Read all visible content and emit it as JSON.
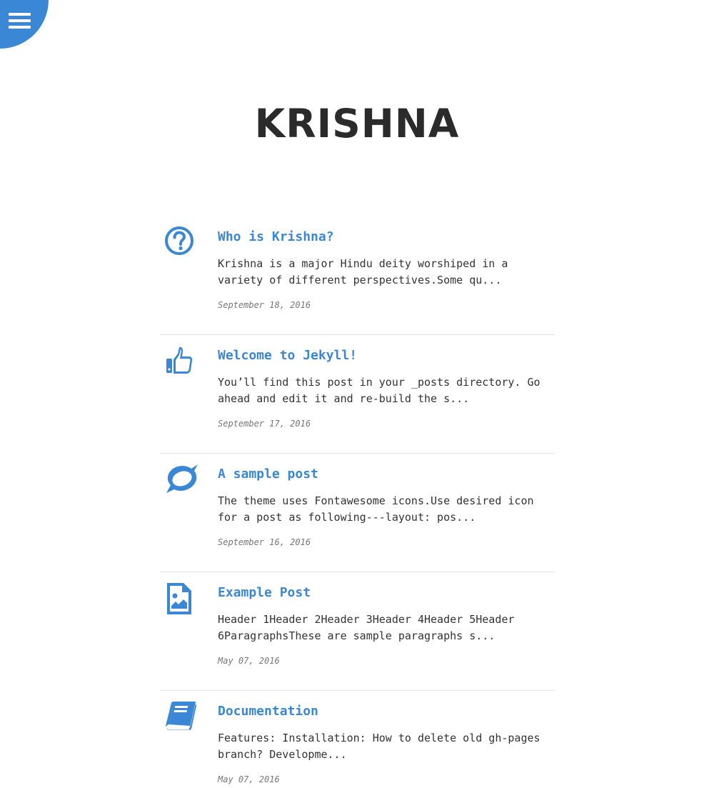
{
  "colors": {
    "accent": "#3a87d6",
    "title": "#2b2b2b",
    "text": "#333333",
    "date": "#777777",
    "divider": "#e3e3e3"
  },
  "menu": {
    "icon": "hamburger-menu-icon"
  },
  "site": {
    "title": "KRISHNA"
  },
  "posts": [
    {
      "icon": "question-circle-icon",
      "title": "Who is Krishna?",
      "excerpt": "Krishna is a major Hindu deity worshiped in a variety of different perspectives.Some qu...",
      "date": "September 18, 2016"
    },
    {
      "icon": "thumbs-up-icon",
      "title": "Welcome to Jekyll!",
      "excerpt": "You’ll find this post in your _posts directory. Go ahead and edit it and re-build the s...",
      "date": "September 17, 2016"
    },
    {
      "icon": "speech-bubble-icon",
      "title": "A sample post",
      "excerpt": "The theme uses Fontawesome icons.Use desired icon for a post as following---layout: pos...",
      "date": "September 16, 2016"
    },
    {
      "icon": "file-image-icon",
      "title": "Example Post",
      "excerpt": "Header 1Header 2Header 3Header 4Header 5Header 6ParagraphsThese are sample paragraphs s...",
      "date": "May 07, 2016"
    },
    {
      "icon": "book-icon",
      "title": "Documentation",
      "excerpt": "Features: Installation: How to delete old gh-pages branch? Developme...",
      "date": "May 07, 2016"
    }
  ]
}
